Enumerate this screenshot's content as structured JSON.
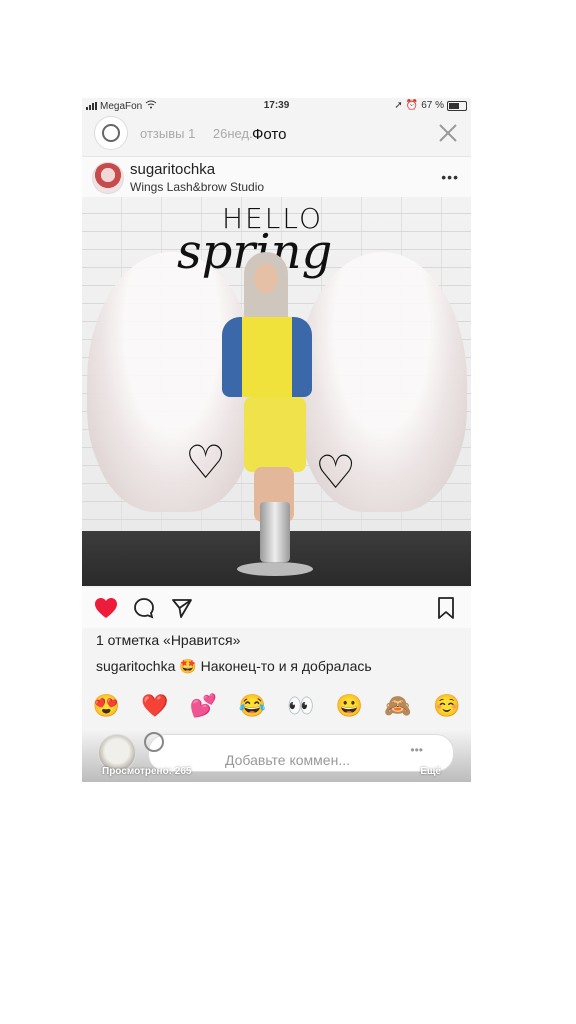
{
  "status_bar": {
    "carrier": "MegaFon",
    "time": "17:39",
    "battery": "67 %"
  },
  "story_header": {
    "tab_reviews": "отзывы 1",
    "time_ago": "26нед.",
    "title": "Фото"
  },
  "post": {
    "username": "sugaritochka",
    "location": "Wings Lash&brow Studio",
    "more_label": "•••",
    "photo": {
      "hello_text": "HELLO",
      "spring_text": "spring"
    },
    "like_count": "1 отметка «Нравится»",
    "caption_user": "sugaritochka",
    "caption_text": "🤩 Наконец-то и я добралась"
  },
  "reactions": [
    "😍",
    "❤️",
    "💕",
    "😂",
    "👀",
    "😀",
    "🙈",
    "☺️"
  ],
  "comment_bar": {
    "placeholder": "Добавьте коммен...",
    "more_label": "•••",
    "viewed": "Просмотрено: 265",
    "more_text": "Ещё"
  },
  "colors": {
    "like_red": "#ed4956"
  }
}
